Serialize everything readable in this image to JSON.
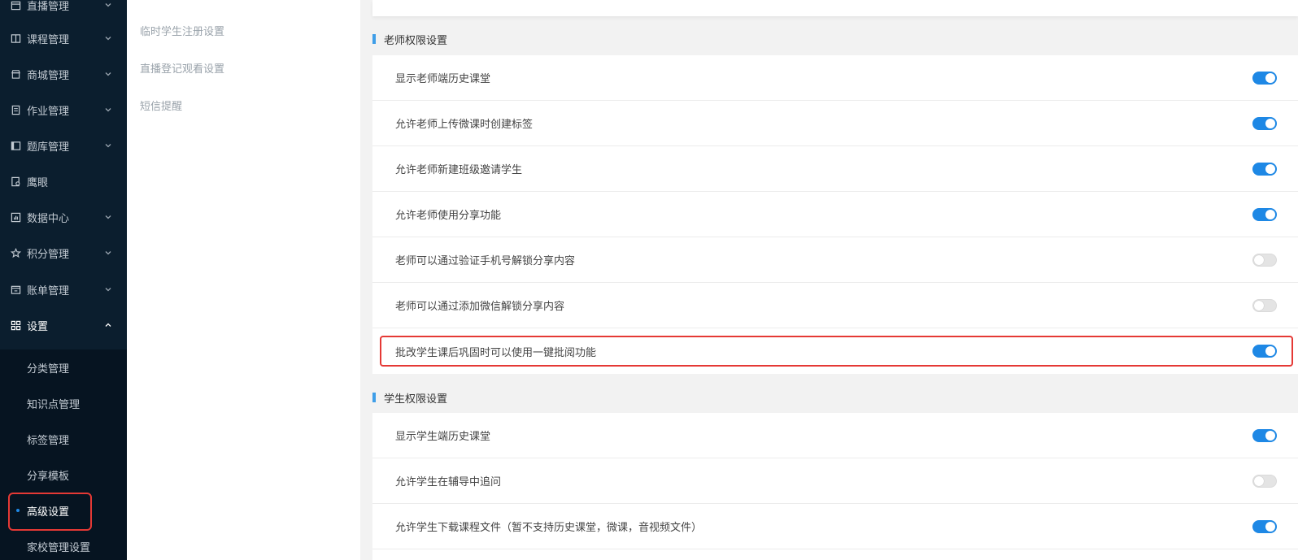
{
  "sidebar": {
    "items": [
      {
        "label": "直播管理",
        "icon": "calendar-icon",
        "chevron": "down"
      },
      {
        "label": "课程管理",
        "icon": "book-icon",
        "chevron": "down"
      },
      {
        "label": "商城管理",
        "icon": "shop-icon",
        "chevron": "down"
      },
      {
        "label": "作业管理",
        "icon": "file-icon",
        "chevron": "down"
      },
      {
        "label": "题库管理",
        "icon": "library-icon",
        "chevron": "down"
      },
      {
        "label": "鹰眼",
        "icon": "monitor-icon",
        "chevron": ""
      },
      {
        "label": "数据中心",
        "icon": "chart-icon",
        "chevron": "down"
      },
      {
        "label": "积分管理",
        "icon": "star-icon",
        "chevron": "down"
      },
      {
        "label": "账单管理",
        "icon": "bill-icon",
        "chevron": "down"
      },
      {
        "label": "设置",
        "icon": "grid-icon",
        "chevron": "up"
      }
    ],
    "sub_items": [
      {
        "label": "分类管理"
      },
      {
        "label": "知识点管理"
      },
      {
        "label": "标签管理"
      },
      {
        "label": "分享模板"
      },
      {
        "label": "高级设置"
      },
      {
        "label": "家校管理设置"
      }
    ]
  },
  "subnav": {
    "links": [
      {
        "label": "临时学生注册设置"
      },
      {
        "label": "直播登记观看设置"
      },
      {
        "label": "短信提醒"
      }
    ]
  },
  "teacher_section": {
    "title": "老师权限设置",
    "rows": [
      {
        "label": "显示老师端历史课堂",
        "enabled": true
      },
      {
        "label": "允许老师上传微课时创建标签",
        "enabled": true
      },
      {
        "label": "允许老师新建班级邀请学生",
        "enabled": true
      },
      {
        "label": "允许老师使用分享功能",
        "enabled": true
      },
      {
        "label": "老师可以通过验证手机号解锁分享内容",
        "enabled": false
      },
      {
        "label": "老师可以通过添加微信解锁分享内容",
        "enabled": false
      },
      {
        "label": "批改学生课后巩固时可以使用一键批阅功能",
        "enabled": true
      }
    ]
  },
  "student_section": {
    "title": "学生权限设置",
    "rows": [
      {
        "label": "显示学生端历史课堂",
        "enabled": true
      },
      {
        "label": "允许学生在辅导中追问",
        "enabled": false
      },
      {
        "label": "允许学生下载课程文件（暂不支持历史课堂，微课，音视频文件）",
        "enabled": true
      }
    ]
  },
  "colors": {
    "accent": "#1e88e5",
    "sidebar_bg": "#0b1e2e",
    "highlight": "#e53935"
  }
}
